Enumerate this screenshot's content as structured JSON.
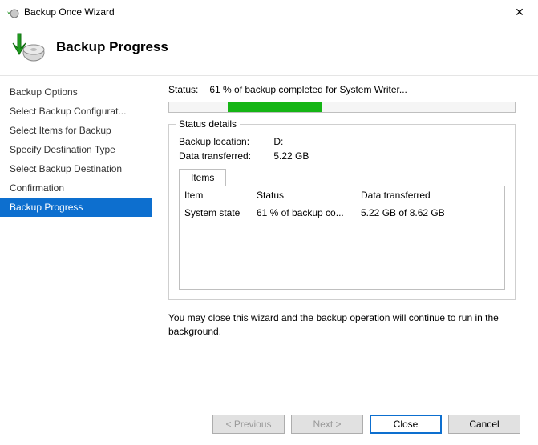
{
  "window": {
    "title": "Backup Once Wizard"
  },
  "header": {
    "title": "Backup Progress"
  },
  "sidebar": {
    "items": [
      {
        "label": "Backup Options"
      },
      {
        "label": "Select Backup Configurat..."
      },
      {
        "label": "Select Items for Backup"
      },
      {
        "label": "Specify Destination Type"
      },
      {
        "label": "Select Backup Destination"
      },
      {
        "label": "Confirmation"
      },
      {
        "label": "Backup Progress"
      }
    ]
  },
  "status": {
    "label": "Status:",
    "text": "61 % of backup completed for System Writer..."
  },
  "details": {
    "legend": "Status details",
    "location_label": "Backup location:",
    "location_value": "D:",
    "transferred_label": "Data transferred:",
    "transferred_value": "5.22 GB",
    "tab": "Items",
    "columns": {
      "c1": "Item",
      "c2": "Status",
      "c3": "Data transferred"
    },
    "row": {
      "c1": "System state",
      "c2": "61 % of backup co...",
      "c3": "5.22 GB of 8.62 GB"
    }
  },
  "hint": "You may close this wizard and the backup operation will continue to run in the background.",
  "buttons": {
    "previous": "< Previous",
    "next": "Next >",
    "close": "Close",
    "cancel": "Cancel"
  }
}
